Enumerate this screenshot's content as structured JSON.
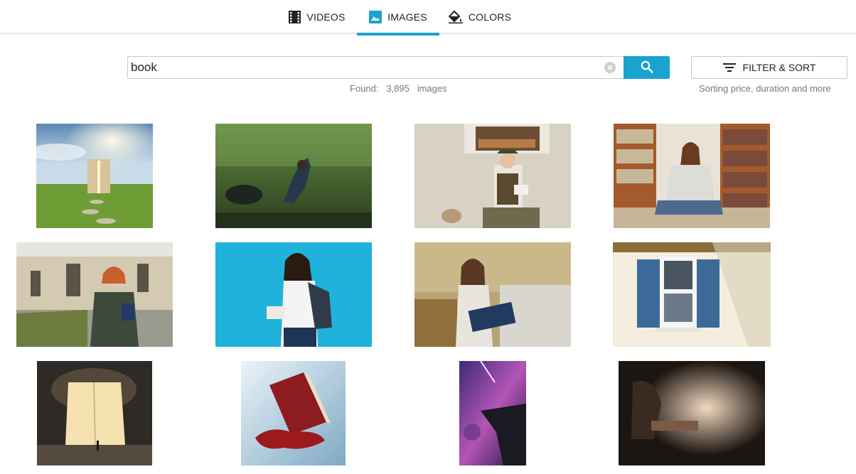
{
  "tabs": [
    {
      "label": "VIDEOS",
      "icon": "film-icon",
      "active": false
    },
    {
      "label": "IMAGES",
      "icon": "image-icon",
      "active": true
    },
    {
      "label": "COLORS",
      "icon": "paint-bucket-icon",
      "active": false
    }
  ],
  "search": {
    "value": "book",
    "clear_icon": "clear-icon",
    "button_icon": "search-icon",
    "found_label": "Found:",
    "found_count": "3,895",
    "found_unit": "images"
  },
  "filter": {
    "label": "FILTER & SORT",
    "icon": "filter-icon",
    "hint": "Sorting price, duration and more"
  },
  "colors": {
    "accent": "#1aa3cf"
  },
  "results": [
    {
      "name": "open-book-doorway-meadow"
    },
    {
      "name": "woman-kneeling-in-rain"
    },
    {
      "name": "old-man-reading-by-window"
    },
    {
      "name": "woman-reading-bookshelf"
    },
    {
      "name": "student-red-hair-campus"
    },
    {
      "name": "student-blue-background"
    },
    {
      "name": "student-autumn-park"
    },
    {
      "name": "window-blue-shutters"
    },
    {
      "name": "giant-glowing-book"
    },
    {
      "name": "melting-holy-bible"
    },
    {
      "name": "cosmic-cliff-figure"
    },
    {
      "name": "book-dust-dark"
    }
  ]
}
